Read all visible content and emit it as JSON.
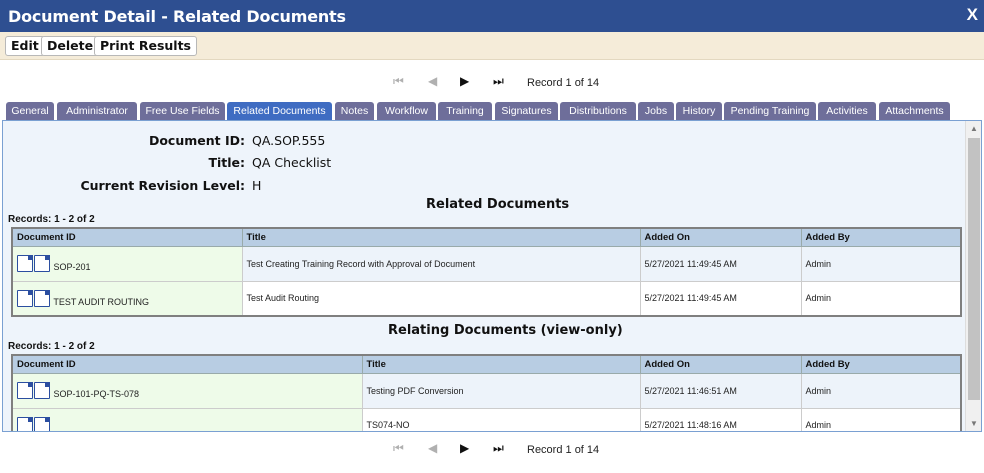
{
  "window": {
    "title": "Document Detail - Related Documents",
    "close": "X"
  },
  "toolbar": {
    "edit": "Edit",
    "delete": "Delete",
    "print": "Print Results"
  },
  "navigation": {
    "record_text": "Record 1 of 14"
  },
  "tabs": [
    "General",
    "Administrator",
    "Free Use Fields",
    "Related Documents",
    "Notes",
    "Workflow",
    "Training",
    "Signatures",
    "Distributions",
    "Jobs",
    "History",
    "Pending Training",
    "Activities",
    "Attachments"
  ],
  "active_tab": "Related Documents",
  "document": {
    "id_label": "Document ID:",
    "id_value": "QA.SOP.555",
    "title_label": "Title:",
    "title_value": "QA Checklist",
    "rev_label": "Current Revision Level:",
    "rev_value": "H"
  },
  "related": {
    "heading": "Related Documents",
    "records": "Records: 1 - 2 of 2",
    "columns": [
      "Document ID",
      "Title",
      "Added On",
      "Added By"
    ],
    "rows": [
      {
        "id": "SOP-201",
        "title": "Test Creating Training Record with Approval of Document",
        "added_on": "5/27/2021 11:49:45 AM",
        "added_by": "Admin"
      },
      {
        "id": "TEST AUDIT ROUTING",
        "title": "Test Audit Routing",
        "added_on": "5/27/2021 11:49:45 AM",
        "added_by": "Admin"
      }
    ]
  },
  "relating": {
    "heading": "Relating Documents (view-only)",
    "records": "Records: 1 - 2 of 2",
    "columns": [
      "Document ID",
      "Title",
      "Added On",
      "Added By"
    ],
    "rows": [
      {
        "id": "SOP-101-PQ-TS-078",
        "title": "Testing PDF Conversion",
        "added_on": "5/27/2021 11:46:51 AM",
        "added_by": "Admin"
      },
      {
        "id": "",
        "title": "TS074-NO",
        "added_on": "5/27/2021 11:48:16 AM",
        "added_by": "Admin"
      }
    ]
  },
  "icons": [
    "view-document-icon",
    "document-info-icon",
    "first-record-icon",
    "previous-record-icon",
    "next-record-icon",
    "last-record-icon",
    "close-icon"
  ]
}
